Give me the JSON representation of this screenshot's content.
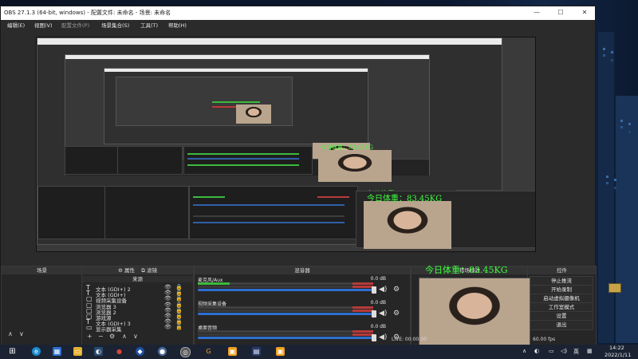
{
  "window": {
    "title": "OBS 27.1.3 (64-bit, windows) - 配置文件: 未命名 - 场景: 未命名",
    "minimize": "—",
    "maximize": "☐",
    "close": "✕"
  },
  "menubar": {
    "items": [
      "编辑(E)",
      "视图(V)",
      "配置文件(P)",
      "场景集合(S)",
      "工具(T)",
      "帮助(H)"
    ]
  },
  "preview": {
    "overlay_text": "今日体重：83.45KG",
    "nested_overlay_text_1": "今日体重：83.45KG",
    "nested_overlay_text_2": "今日体重：83.45KG"
  },
  "docks": {
    "scenes": {
      "title": "场景"
    },
    "sources": {
      "title": "来源",
      "properties_label": "属性",
      "filters_label": "滤镜",
      "items": [
        {
          "icon": "T",
          "name": "文本 (GDI+) 2",
          "eye": "👁",
          "lock": "🔒"
        },
        {
          "icon": "T",
          "name": "文本 (GDI+)",
          "eye": "👁",
          "lock": "🔒"
        },
        {
          "icon": "▢",
          "name": "视频采集设备",
          "eye": "👁",
          "lock": "🔒"
        },
        {
          "icon": "▢",
          "name": "浏览器 3",
          "eye": "👁",
          "lock": "🔒"
        },
        {
          "icon": "▢",
          "name": "浏览器 2",
          "eye": "👁",
          "lock": "🔒"
        },
        {
          "icon": "▢",
          "name": "游戏源",
          "eye": "👁",
          "lock": "🔒"
        },
        {
          "icon": "T",
          "name": "文本 (GDI+) 3",
          "eye": "👁",
          "lock": "🔒"
        },
        {
          "icon": "▭",
          "name": "显示器采集",
          "eye": "👁",
          "lock": "🔒"
        }
      ]
    },
    "mixer": {
      "title": "混音器",
      "channels": [
        {
          "name": "麦克风/Aux",
          "db": "0.0 dB"
        },
        {
          "name": "视频采集设备",
          "db": "0.0 dB"
        },
        {
          "name": "桌面音频",
          "db": "0.0 dB"
        }
      ]
    },
    "transitions": {
      "title": "转场特效",
      "fade_label": "渐变"
    },
    "controls": {
      "title": "控件",
      "buttons": [
        "停止推流",
        "开始录制",
        "启动虚拟摄像机",
        "工作室模式",
        "设置",
        "退出"
      ]
    }
  },
  "statusbar": {
    "live_label": "LIVE: 00:00:30",
    "fps": "60.00 fps"
  },
  "taskbar": {
    "time": "14:22",
    "date": "2022/1/11",
    "ime": "英"
  },
  "colors": {
    "overlay_green": "#3cff3c",
    "meter_green": "#3cba3c",
    "meter_red": "#b83a3a",
    "slider_blue": "#2f6fd0"
  }
}
